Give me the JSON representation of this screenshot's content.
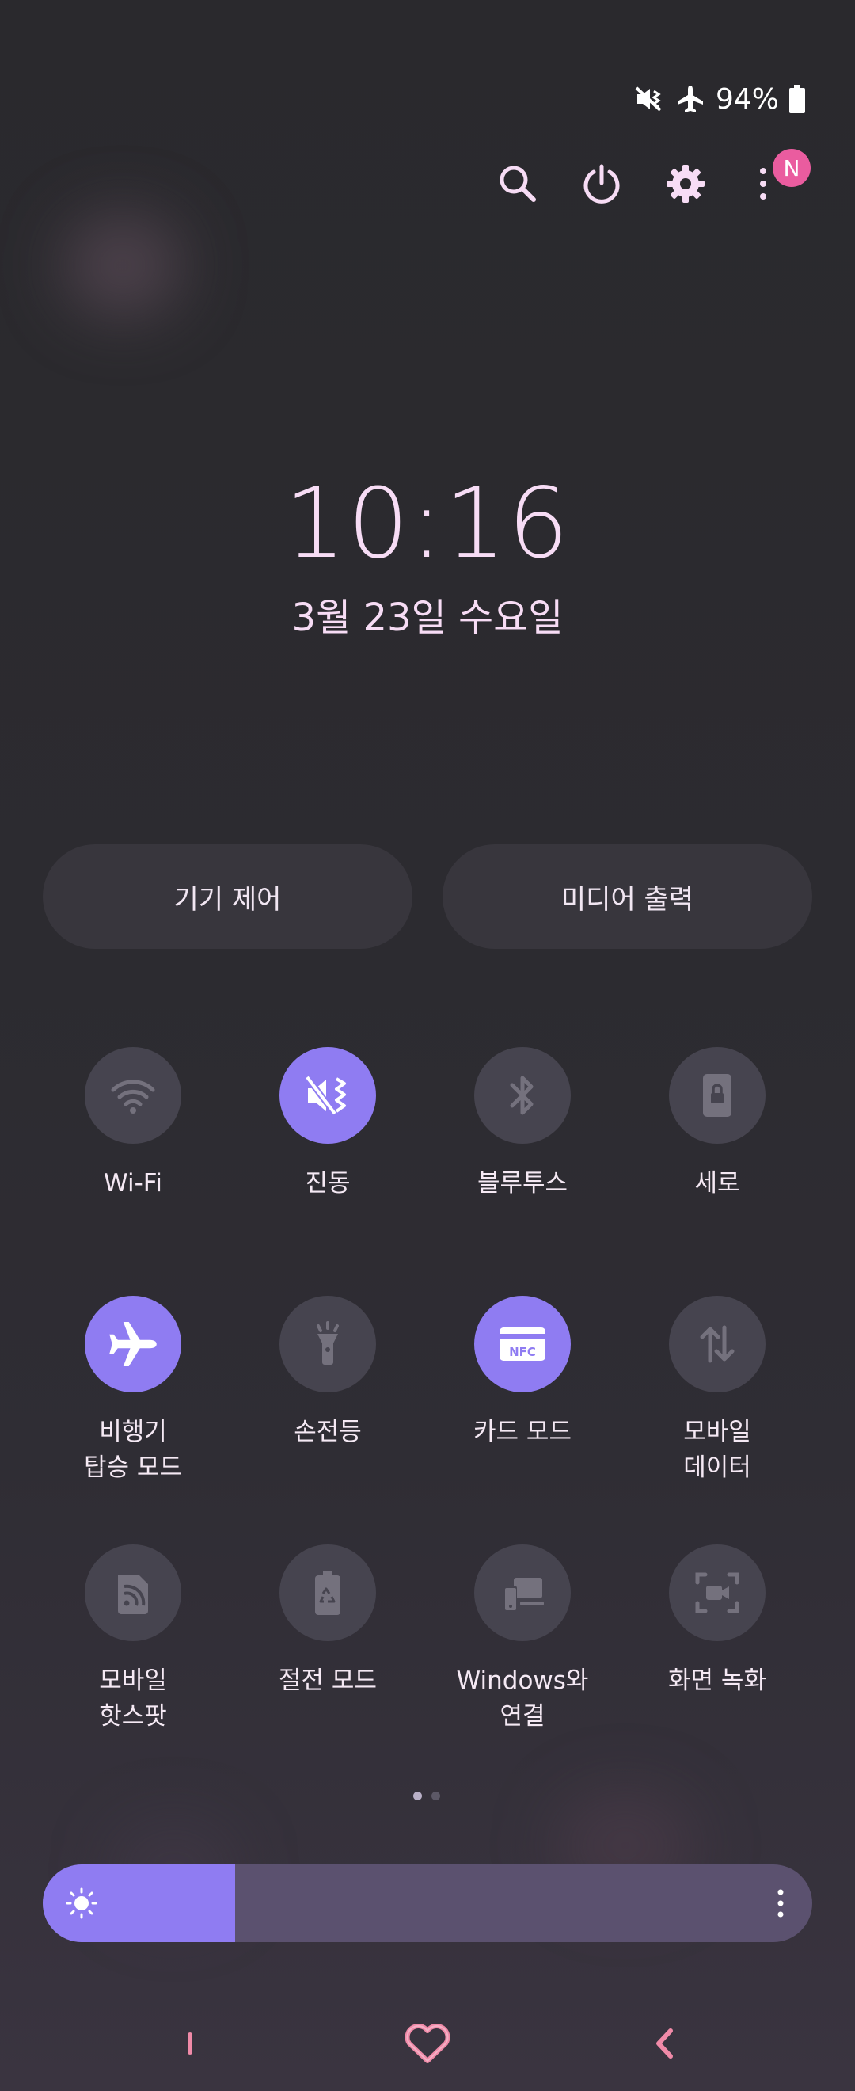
{
  "status_bar": {
    "battery_percent": "94%",
    "icons": [
      "vibrate-mute-icon",
      "airplane-icon",
      "battery-icon"
    ]
  },
  "top_bar": {
    "icons": [
      "search-icon",
      "power-icon",
      "settings-gear-icon",
      "more-vert-icon"
    ],
    "notification_badge": "N"
  },
  "clock": {
    "time": "10:16",
    "date": "3월 23일 수요일"
  },
  "buttons": {
    "device_control": "기기 제어",
    "media_output": "미디어 출력"
  },
  "tiles": [
    {
      "icon": "wifi-icon",
      "label_lines": [
        "Wi-Fi"
      ],
      "active": false
    },
    {
      "icon": "vibrate-icon",
      "label_lines": [
        "진동"
      ],
      "active": true
    },
    {
      "icon": "bluetooth-icon",
      "label_lines": [
        "블루투스"
      ],
      "active": false
    },
    {
      "icon": "portrait-lock-icon",
      "label_lines": [
        "세로"
      ],
      "active": false
    },
    {
      "icon": "airplane-icon",
      "label_lines": [
        "비행기",
        "탑승 모드"
      ],
      "active": true
    },
    {
      "icon": "flashlight-icon",
      "label_lines": [
        "손전등"
      ],
      "active": false
    },
    {
      "icon": "nfc-card-icon",
      "label_lines": [
        "카드 모드"
      ],
      "active": true,
      "icon_text": "NFC"
    },
    {
      "icon": "mobile-data-icon",
      "label_lines": [
        "모바일",
        "데이터"
      ],
      "active": false
    },
    {
      "icon": "hotspot-icon",
      "label_lines": [
        "모바일",
        "핫스팟"
      ],
      "active": false
    },
    {
      "icon": "power-saving-icon",
      "label_lines": [
        "절전 모드"
      ],
      "active": false
    },
    {
      "icon": "link-windows-icon",
      "label_lines": [
        "Windows와",
        "연결"
      ],
      "active": false
    },
    {
      "icon": "screen-record-icon",
      "label_lines": [
        "화면 녹화"
      ],
      "active": false
    }
  ],
  "pager": {
    "pages": 2,
    "current": 1
  },
  "brightness": {
    "level": 0.25
  },
  "nav": [
    "recents-icon",
    "home-heart-icon",
    "back-icon"
  ],
  "colors": {
    "accent": "#8f7cf2",
    "tile_off": "#46444f",
    "badge": "#ea5c9f",
    "nav_pink": "#f08aa8"
  }
}
